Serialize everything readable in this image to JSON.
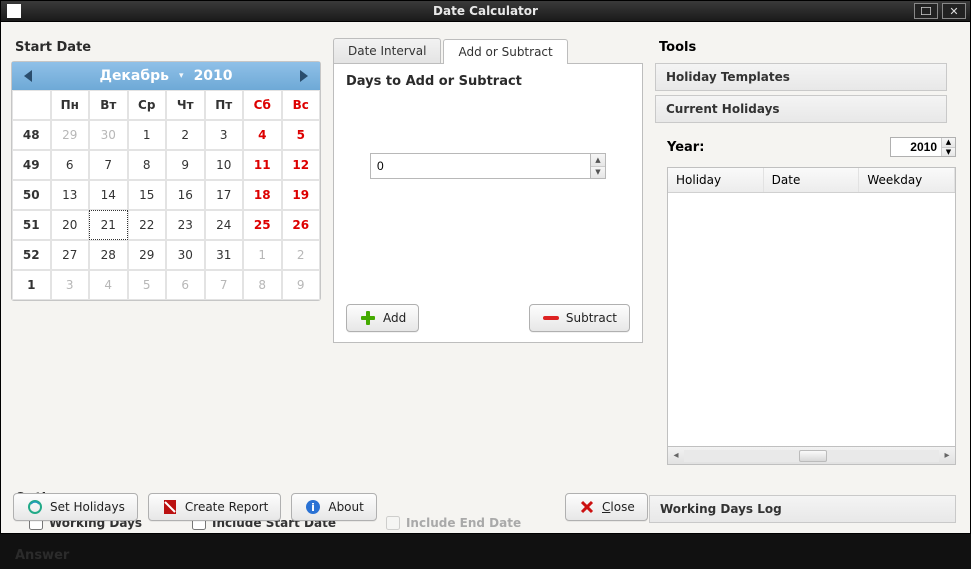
{
  "window": {
    "title": "Date Calculator"
  },
  "left": {
    "start_date_label": "Start Date",
    "calendar": {
      "month": "Декабрь",
      "year": "2010",
      "weekdays_wk": "",
      "weekdays": [
        "Пн",
        "Вт",
        "Ср",
        "Чт",
        "Пт",
        "Сб",
        "Вс"
      ],
      "rows": [
        {
          "wk": "48",
          "days": [
            {
              "n": "29",
              "om": true
            },
            {
              "n": "30",
              "om": true
            },
            {
              "n": "1"
            },
            {
              "n": "2"
            },
            {
              "n": "3"
            },
            {
              "n": "4",
              "we": true
            },
            {
              "n": "5",
              "we": true
            }
          ]
        },
        {
          "wk": "49",
          "days": [
            {
              "n": "6"
            },
            {
              "n": "7"
            },
            {
              "n": "8"
            },
            {
              "n": "9"
            },
            {
              "n": "10"
            },
            {
              "n": "11",
              "we": true
            },
            {
              "n": "12",
              "we": true
            }
          ]
        },
        {
          "wk": "50",
          "days": [
            {
              "n": "13"
            },
            {
              "n": "14"
            },
            {
              "n": "15"
            },
            {
              "n": "16"
            },
            {
              "n": "17"
            },
            {
              "n": "18",
              "we": true
            },
            {
              "n": "19",
              "we": true
            }
          ]
        },
        {
          "wk": "51",
          "days": [
            {
              "n": "20"
            },
            {
              "n": "21",
              "sel": true
            },
            {
              "n": "22"
            },
            {
              "n": "23"
            },
            {
              "n": "24"
            },
            {
              "n": "25",
              "we": true
            },
            {
              "n": "26",
              "we": true
            }
          ]
        },
        {
          "wk": "52",
          "days": [
            {
              "n": "27"
            },
            {
              "n": "28"
            },
            {
              "n": "29"
            },
            {
              "n": "30"
            },
            {
              "n": "31"
            },
            {
              "n": "1",
              "om": true
            },
            {
              "n": "2",
              "om": true
            }
          ]
        },
        {
          "wk": "1",
          "days": [
            {
              "n": "3",
              "om": true
            },
            {
              "n": "4",
              "om": true
            },
            {
              "n": "5",
              "om": true
            },
            {
              "n": "6",
              "om": true
            },
            {
              "n": "7",
              "om": true
            },
            {
              "n": "8",
              "om": true
            },
            {
              "n": "9",
              "om": true
            }
          ]
        }
      ]
    }
  },
  "tabs": {
    "interval": "Date Interval",
    "addsub": "Add or Subtract",
    "panel_label": "Days to Add or Subtract",
    "spin_value": "0",
    "add_label": "Add",
    "subtract_label": "Subtract"
  },
  "options": {
    "header": "Options",
    "working_days": "Working Days",
    "include_start": "Include Start Date",
    "include_end": "Include End Date",
    "answer_header": "Answer"
  },
  "tools": {
    "header": "Tools",
    "holiday_templates": "Holiday Templates",
    "current_holidays": "Current Holidays",
    "year_label": "Year:",
    "year_value": "2010",
    "columns": {
      "holiday": "Holiday",
      "date": "Date",
      "weekday": "Weekday"
    },
    "working_days_log": "Working Days Log"
  },
  "footer": {
    "set_holidays": "Set Holidays",
    "create_report": "Create Report",
    "about": "About",
    "close": "Close"
  }
}
